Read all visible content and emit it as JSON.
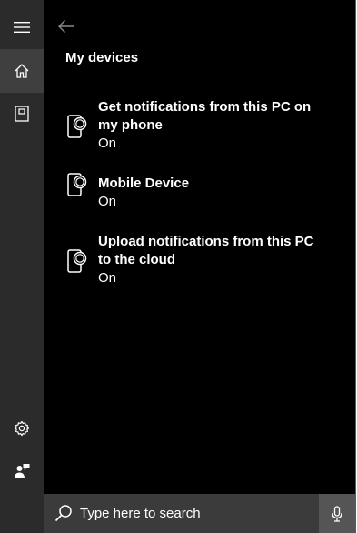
{
  "rail": {
    "items": [
      {
        "name": "menu",
        "icon": "hamburger-menu-icon"
      },
      {
        "name": "home",
        "icon": "home-icon",
        "active": true
      },
      {
        "name": "notebook",
        "icon": "notebook-icon"
      },
      {
        "name": "settings",
        "icon": "gear-icon"
      },
      {
        "name": "feedback",
        "icon": "feedback-icon"
      }
    ]
  },
  "header": {
    "back_icon": "back-arrow-icon",
    "title": "My devices"
  },
  "devices": [
    {
      "name": "Get notifications from this PC on my phone",
      "status": "On",
      "icon": "phone-device-icon"
    },
    {
      "name": "Mobile Device",
      "status": "On",
      "icon": "phone-device-icon"
    },
    {
      "name": "Upload notifications from this PC to the cloud",
      "status": "On",
      "icon": "phone-device-icon"
    }
  ],
  "search": {
    "placeholder": "Type here to search",
    "value": "",
    "icon": "search-icon",
    "mic_icon": "microphone-icon"
  },
  "colors": {
    "background": "#000000",
    "rail": "#2b2b2b",
    "rail_active": "#3f3f3f",
    "searchbar": "#3b3b3b",
    "mic_button": "#555555",
    "text": "#ffffff"
  }
}
